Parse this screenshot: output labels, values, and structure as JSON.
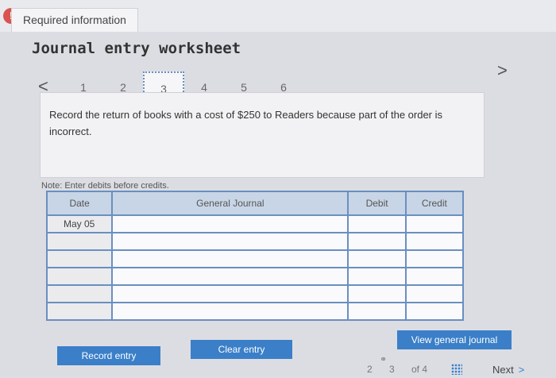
{
  "header": {
    "alert_glyph": "!",
    "required_label": "Required information"
  },
  "worksheet": {
    "title": "Journal entry worksheet",
    "prev_glyph": "<",
    "next_glyph": ">",
    "steps": [
      "1",
      "2",
      "3",
      "4",
      "5",
      "6"
    ],
    "active_step": "3",
    "instruction": "Record the return of books with a cost of $250 to Readers because part of the order is incorrect.",
    "note": "Note: Enter debits before credits."
  },
  "journal": {
    "columns": [
      "Date",
      "General Journal",
      "Debit",
      "Credit"
    ],
    "rows": [
      {
        "date": "May 05",
        "account": "",
        "debit": "",
        "credit": ""
      },
      {
        "date": "",
        "account": "",
        "debit": "",
        "credit": ""
      },
      {
        "date": "",
        "account": "",
        "debit": "",
        "credit": ""
      },
      {
        "date": "",
        "account": "",
        "debit": "",
        "credit": ""
      },
      {
        "date": "",
        "account": "",
        "debit": "",
        "credit": ""
      },
      {
        "date": "",
        "account": "",
        "debit": "",
        "credit": ""
      }
    ]
  },
  "buttons": {
    "record_entry": "Record entry",
    "clear_entry": "Clear entry",
    "view_general_journal": "View general journal"
  },
  "pager": {
    "current": "2",
    "page": "3",
    "of_label": "of 4",
    "next_label": "Next",
    "next_glyph": ">"
  }
}
